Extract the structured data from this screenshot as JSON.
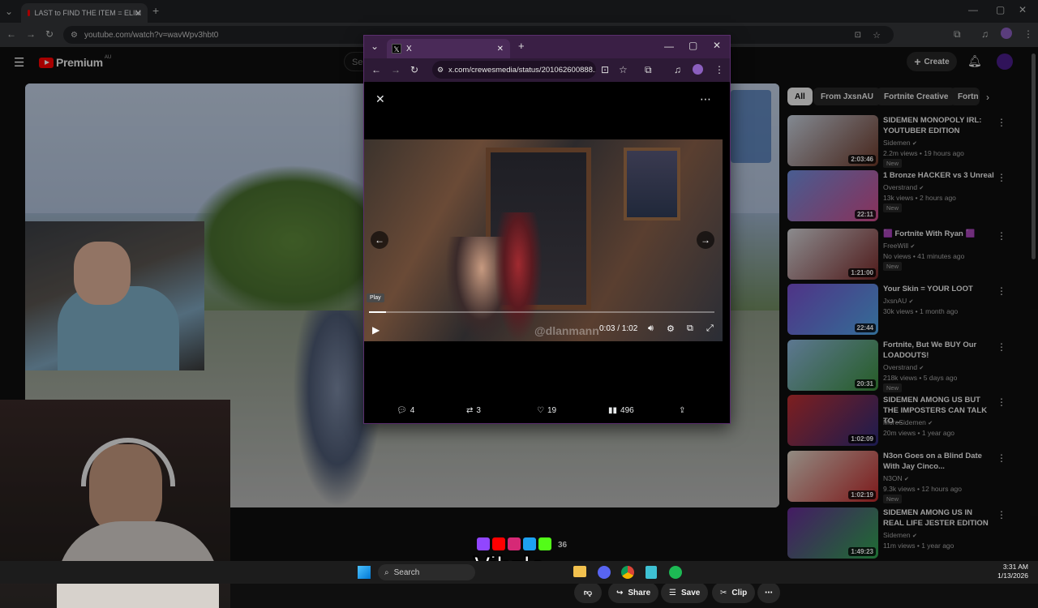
{
  "browser": {
    "tab_title": "LAST to FIND THE ITEM = ELIM",
    "url": "youtube.com/watch?v=wavWpv3hbt0"
  },
  "youtube": {
    "logo": "Premium",
    "region": "AU",
    "search_placeholder": "Se",
    "create_label": "Create",
    "chips": [
      "All",
      "From JxsnAU",
      "Fortnite Creative",
      "Fortn"
    ],
    "recommendations": [
      {
        "title": "SIDEMEN MONOPOLY IRL: YOUTUBER EDITION",
        "channel": "Sidemen",
        "meta": "2.2m views • 19 hours ago",
        "badge": "New",
        "duration": "2:03:46",
        "colors": [
          "#c9d3e0",
          "#6e3a2a"
        ]
      },
      {
        "title": "1 Bronze HACKER vs 3 Unreal",
        "channel": "Overstrand",
        "meta": "13k views • 2 hours ago",
        "badge": "New",
        "duration": "22:11",
        "colors": [
          "#6f8fe0",
          "#d24c8c"
        ]
      },
      {
        "title": "🟪 Fortnite With Ryan 🟪",
        "channel": "FreeWill",
        "meta": "No views • 41 minutes ago",
        "badge": "New",
        "duration": "1:21:00",
        "colors": [
          "#d6d6da",
          "#7a2a2a"
        ]
      },
      {
        "title": "Your Skin = YOUR LOOT",
        "channel": "JxsnAU",
        "meta": "30k views • 1 month ago",
        "badge": "",
        "duration": "22:44",
        "colors": [
          "#7a4fd0",
          "#4fa8e8"
        ]
      },
      {
        "title": "Fortnite, But We BUY Our LOADOUTS!",
        "channel": "Overstrand",
        "meta": "218k views • 5 days ago",
        "badge": "New",
        "duration": "20:31",
        "colors": [
          "#8fb8e0",
          "#3a8f3a"
        ]
      },
      {
        "title": "SIDEMEN AMONG US BUT THE IMPOSTERS CAN TALK TO ...",
        "channel": "MoreSidemen",
        "meta": "20m views • 1 year ago",
        "badge": "",
        "duration": "1:02:09",
        "colors": [
          "#c23030",
          "#2a2a7a"
        ]
      },
      {
        "title": "N3on Goes on a Blind Date With Jay Cinco...",
        "channel": "N3ON",
        "meta": "9.3k views • 12 hours ago",
        "badge": "New",
        "duration": "1:02:19",
        "colors": [
          "#e0d6c8",
          "#c0282a"
        ]
      },
      {
        "title": "SIDEMEN AMONG US IN REAL LIFE JESTER EDITION",
        "channel": "Sidemen",
        "meta": "11m views • 1 year ago",
        "badge": "",
        "duration": "1:49:23",
        "colors": [
          "#6a2a9a",
          "#2fa84f"
        ]
      }
    ],
    "actions": {
      "like_count": "36",
      "share": "Share",
      "save": "Save",
      "clip": "Clip"
    }
  },
  "xwindow": {
    "tab_title": "X",
    "url": "x.com/crewesmedia/status/201062600888...",
    "play_tooltip": "Play",
    "time": "0:03 / 1:02",
    "watermark": "@dlanmann",
    "stats": {
      "replies": "4",
      "reposts": "3",
      "likes": "19",
      "views": "496"
    }
  },
  "overlay": {
    "brand": "Vibzlo"
  },
  "taskbar": {
    "search": "Search",
    "time": "3:31 AM",
    "date": "1/13/2026"
  }
}
